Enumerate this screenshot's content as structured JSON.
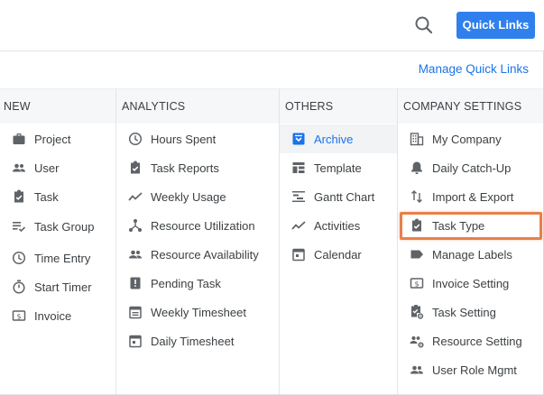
{
  "topbar": {
    "search_icon": "search-icon",
    "quick_links_label": "Quick Links"
  },
  "panel": {
    "manage_link": "Manage Quick Links",
    "columns": [
      {
        "header": "NEW",
        "items": [
          {
            "label": "Project",
            "icon": "briefcase-icon"
          },
          {
            "label": "User",
            "icon": "users-icon"
          },
          {
            "label": "Task",
            "icon": "clipboard-check-icon"
          },
          {
            "label": "Task Group",
            "icon": "list-check-icon"
          },
          {
            "label": "Time Entry",
            "icon": "clock-icon"
          },
          {
            "label": "Start Timer",
            "icon": "timer-icon"
          },
          {
            "label": "Invoice",
            "icon": "invoice-icon"
          }
        ]
      },
      {
        "header": "ANALYTICS",
        "items": [
          {
            "label": "Hours Spent",
            "icon": "clock-icon"
          },
          {
            "label": "Task Reports",
            "icon": "clipboard-check-icon"
          },
          {
            "label": "Weekly Usage",
            "icon": "trend-line-icon"
          },
          {
            "label": "Resource Utilization",
            "icon": "network-icon"
          },
          {
            "label": "Resource Availability",
            "icon": "users-icon"
          },
          {
            "label": "Pending Task",
            "icon": "alert-clipboard-icon"
          },
          {
            "label": "Weekly Timesheet",
            "icon": "calendar-list-icon"
          },
          {
            "label": "Daily Timesheet",
            "icon": "calendar-icon"
          }
        ]
      },
      {
        "header": "OTHERS",
        "items": [
          {
            "label": "Archive",
            "icon": "archive-icon",
            "active": true
          },
          {
            "label": "Template",
            "icon": "template-icon"
          },
          {
            "label": "Gantt Chart",
            "icon": "gantt-icon"
          },
          {
            "label": "Activities",
            "icon": "trend-line-icon"
          },
          {
            "label": "Calendar",
            "icon": "calendar-icon"
          }
        ]
      },
      {
        "header": "COMPANY SETTINGS",
        "items": [
          {
            "label": "My Company",
            "icon": "building-icon"
          },
          {
            "label": "Daily Catch-Up",
            "icon": "bell-icon"
          },
          {
            "label": "Import & Export",
            "icon": "swap-vertical-icon"
          },
          {
            "label": "Task Type",
            "icon": "clipboard-check-icon",
            "highlighted": true
          },
          {
            "label": "Manage Labels",
            "icon": "label-icon"
          },
          {
            "label": "Invoice Setting",
            "icon": "invoice-icon"
          },
          {
            "label": "Task Setting",
            "icon": "clipboard-gear-icon"
          },
          {
            "label": "Resource Setting",
            "icon": "users-gear-icon"
          },
          {
            "label": "User Role Mgmt",
            "icon": "users-icon"
          }
        ]
      }
    ]
  },
  "colors": {
    "accent": "#2f80ed",
    "link": "#1a73e8",
    "highlight": "#e8804a"
  }
}
